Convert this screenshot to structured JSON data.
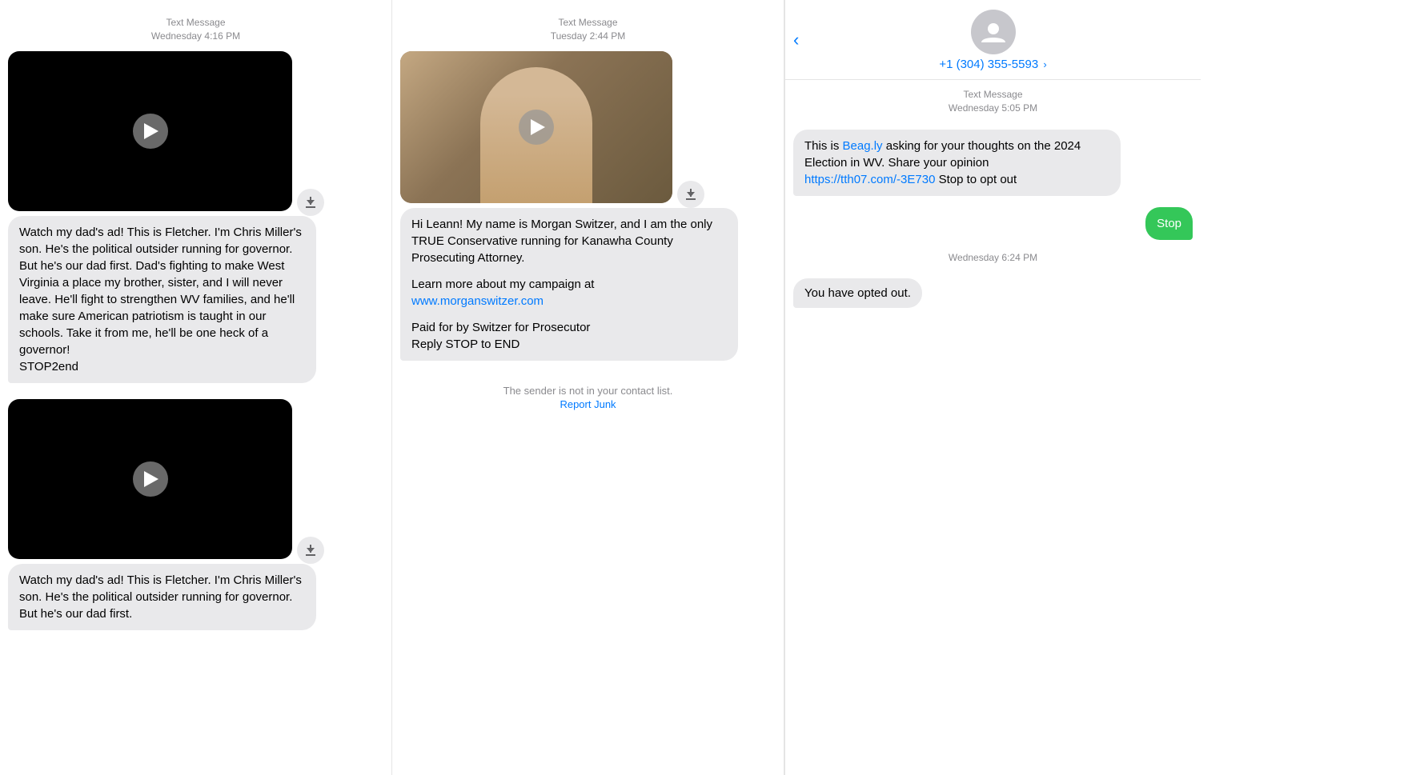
{
  "columns": {
    "left": {
      "messages": [
        {
          "timestamp_line1": "Text Message",
          "timestamp_line2": "Wednesday 4:16 PM",
          "has_video": true,
          "text": "Watch my dad's ad! This is Fletcher. I'm Chris Miller's son. He's the political outsider running for governor. But he's our dad first. Dad's fighting to make West Virginia a place my brother, sister, and I will never leave. He'll fight to strengthen WV families, and he'll make sure American patriotism is taught in our schools. Take it from me, he'll be one heck of a governor!\nSTOP2end"
        },
        {
          "timestamp_line1": "",
          "timestamp_line2": "",
          "has_video": true,
          "text": "Watch my dad's ad! This is Fletcher. I'm Chris Miller's son. He's the political outsider running for governor. But he's our dad first."
        }
      ]
    },
    "middle": {
      "timestamp_line1": "Text Message",
      "timestamp_line2": "Tuesday 2:44 PM",
      "has_video": true,
      "message_text_1": "Hi Leann! My name is Morgan Switzer, and I am the only TRUE Conservative running for Kanawha County Prosecuting Attorney.",
      "message_text_2": "Learn more about my campaign at",
      "message_link": "www.morganswitzer.com",
      "message_text_3": "Paid for by Switzer for Prosecutor\nReply STOP to END",
      "sender_notice": "The sender is not in your contact list.",
      "report_junk": "Report Junk"
    },
    "right": {
      "contact_number": "+1 (304) 355-5593",
      "timestamp_line1": "Text Message",
      "timestamp_line2": "Wednesday 5:05 PM",
      "incoming_text_before": "This is ",
      "incoming_link1": "Beag.ly",
      "incoming_link1_url": "https://beag.ly",
      "incoming_text_middle": " asking for your thoughts on the 2024 Election in WV. Share your opinion ",
      "incoming_link2": "https://tth07.com/-3E730",
      "incoming_text_after": " Stop to opt out",
      "sent_message": "Stop",
      "opt_out_timestamp": "Wednesday 6:24 PM",
      "opt_out_text": "You have opted out."
    }
  },
  "icons": {
    "play": "▶",
    "back": "‹",
    "chevron": "›",
    "person": "👤",
    "download": "⬇"
  }
}
